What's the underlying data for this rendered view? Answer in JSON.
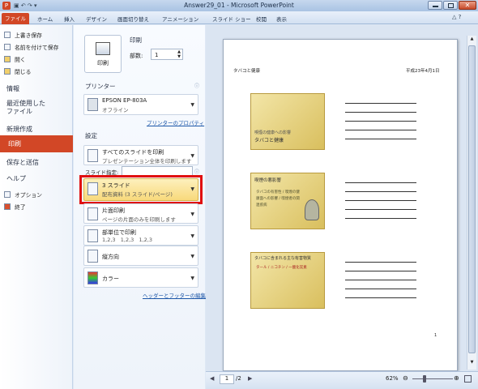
{
  "window": {
    "title": "Answer29_01 - Microsoft PowerPoint"
  },
  "ribbon": {
    "tabs": [
      "ファイル",
      "ホーム",
      "挿入",
      "デザイン",
      "画面切り替え",
      "アニメーション",
      "スライド ショー",
      "校閲",
      "表示"
    ]
  },
  "nav": {
    "small_top": [
      "上書き保存",
      "名前を付けて保存",
      "開く",
      "閉じる"
    ],
    "big": [
      "情報",
      "最近使用した\nファイル",
      "新規作成",
      "印刷",
      "保存と送信",
      "ヘルプ"
    ],
    "small_bottom": [
      "オプション",
      "終了"
    ]
  },
  "print": {
    "print_button": "印刷",
    "section_title": "印刷",
    "copies_label": "部数:",
    "copies_value": "1"
  },
  "printer": {
    "section": "プリンター",
    "name": "EPSON EP-803A",
    "status": "オフライン",
    "properties_link": "プリンターのプロパティ"
  },
  "settings": {
    "section": "設定",
    "range_t1": "すべてのスライドを印刷",
    "range_t2": "プレゼンテーション全体を印刷します",
    "slides_label": "スライド指定:",
    "layout_t1": "3 スライド",
    "layout_t2": "配布資料 (3 スライド/ページ)",
    "sides_t1": "片面印刷",
    "sides_t2": "ページの片面のみを印刷します",
    "collate_t1": "部単位で印刷",
    "collate_t2": "1,2,3   1,2,3   1,2,3",
    "orient_t1": "縦方向",
    "color_t1": "カラー",
    "header_footer_link": "ヘッダーとフッターの編集"
  },
  "preview": {
    "header_left": "タバコと健康",
    "header_right": "平成23年4月1日",
    "slides": [
      {
        "title": "タバコと健康",
        "sub": "喫煙の健康への影響"
      },
      {
        "title": "喫煙の悪影響",
        "sub": "タバコの有害性 / 喫煙の健康面への影響 / 喫煙者の関連疾病"
      },
      {
        "title": "タバコに含まれる主な有害物質",
        "sub": "タール / ニコチン / 一酸化炭素"
      }
    ],
    "page_number": "1"
  },
  "status": {
    "page_current": "1",
    "page_total": "/2",
    "zoom": "62%"
  },
  "colors": {
    "accent": "#d24726",
    "highlight_box": "#e01010",
    "selected_item": "#fbe39a"
  }
}
